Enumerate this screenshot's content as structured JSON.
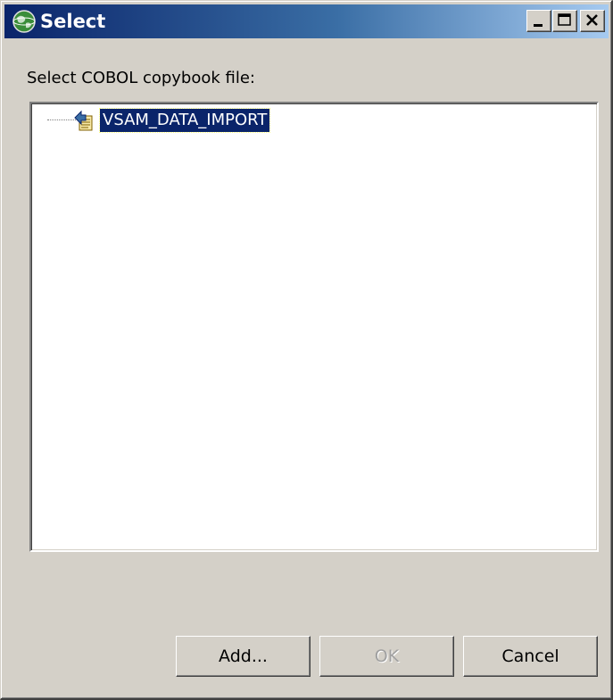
{
  "window": {
    "title": "Select",
    "app_icon": "globe-icon",
    "caption_buttons": [
      "minimize-icon",
      "maximize-icon",
      "close-icon"
    ]
  },
  "prompt": "Select COBOL copybook file:",
  "tree": {
    "items": [
      {
        "label": "VSAM_DATA_IMPORT",
        "icon": "copybook-file-icon",
        "selected": true
      }
    ]
  },
  "buttons": {
    "add_label": "Add...",
    "ok_label": "OK",
    "ok_enabled": false,
    "cancel_label": "Cancel"
  },
  "colors": {
    "title_gradient_start": "#0a246a",
    "title_gradient_end": "#a6caf0",
    "selection": "#0a246a",
    "dialog_face": "#d4d0c8"
  }
}
